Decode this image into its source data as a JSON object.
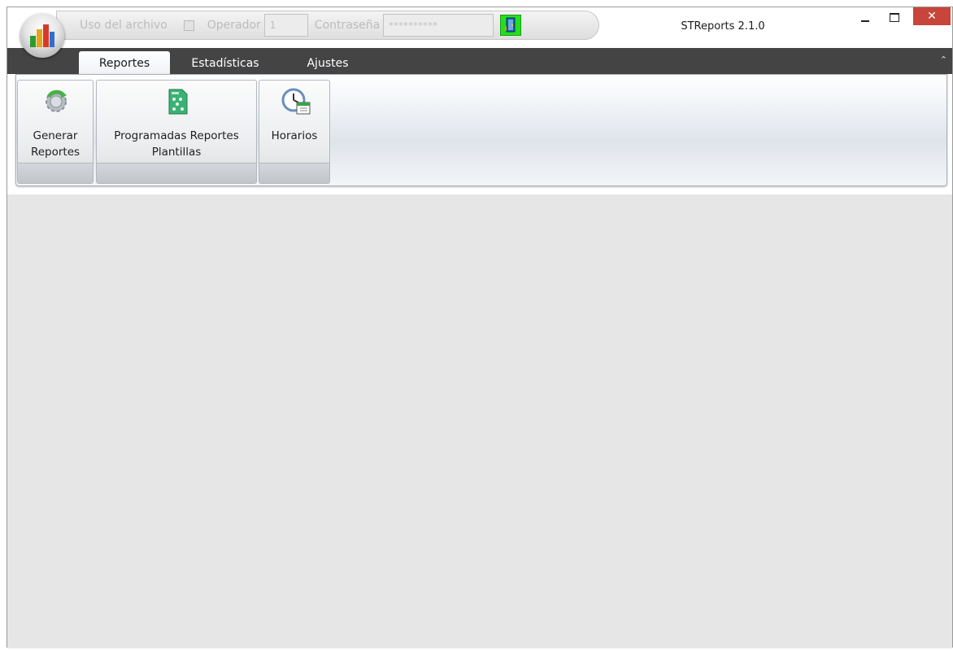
{
  "titlebar": {
    "app_title": "STReports 2.1.0",
    "file_usage_label": "Uso del archivo",
    "operator_label": "Operador",
    "operator_value": "1",
    "password_label": "Contraseña",
    "password_value": "**********",
    "close_glyph": "✕"
  },
  "tabs": [
    {
      "label": "Reportes",
      "active": true
    },
    {
      "label": "Estadísticas",
      "active": false
    },
    {
      "label": "Ajustes",
      "active": false
    }
  ],
  "ribbon": {
    "collapse_glyph": "⌃",
    "buttons": [
      {
        "label": "Generar Reportes",
        "icon": "gear-refresh-icon"
      },
      {
        "label": "Programadas Reportes Plantillas",
        "icon": "template-document-icon"
      },
      {
        "label": "Horarios",
        "icon": "clock-calendar-icon"
      }
    ]
  },
  "colors": {
    "tab_bar": "#444444",
    "close_button": "#c7453a",
    "workspace": "#e6e6e6",
    "exit_icon": "#22e01c"
  }
}
